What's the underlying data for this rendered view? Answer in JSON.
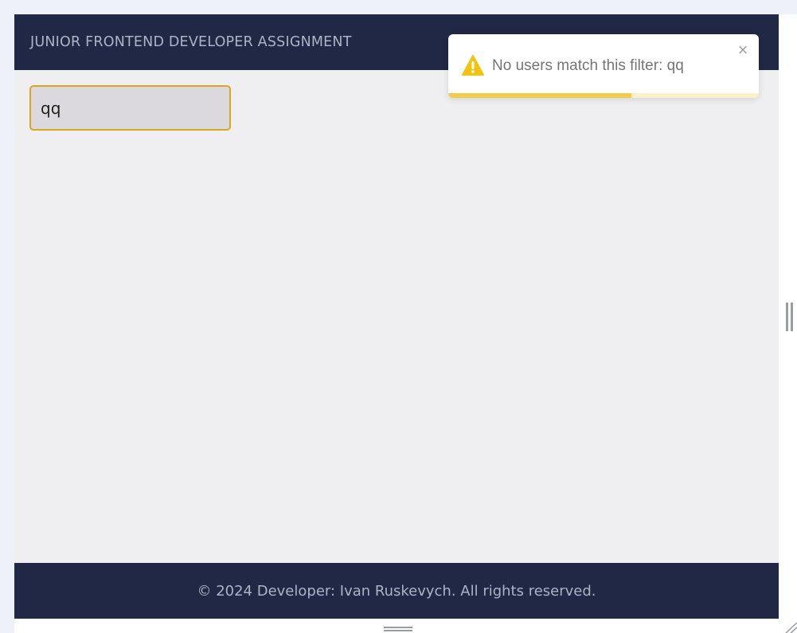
{
  "header": {
    "title": "JUNIOR FRONTEND DEVELOPER ASSIGNMENT"
  },
  "search": {
    "value": "qq"
  },
  "toast": {
    "message": "No users match this filter: qq",
    "close_symbol": "×",
    "icon": "warning-icon",
    "progress": 0.59,
    "color": "#f0cc4c"
  },
  "footer": {
    "text": "© 2024 Developer: Ivan Ruskevych. All rights reserved."
  },
  "colors": {
    "header_bg": "#212845",
    "accent": "#d8a621",
    "warning": "#f1c40f"
  }
}
